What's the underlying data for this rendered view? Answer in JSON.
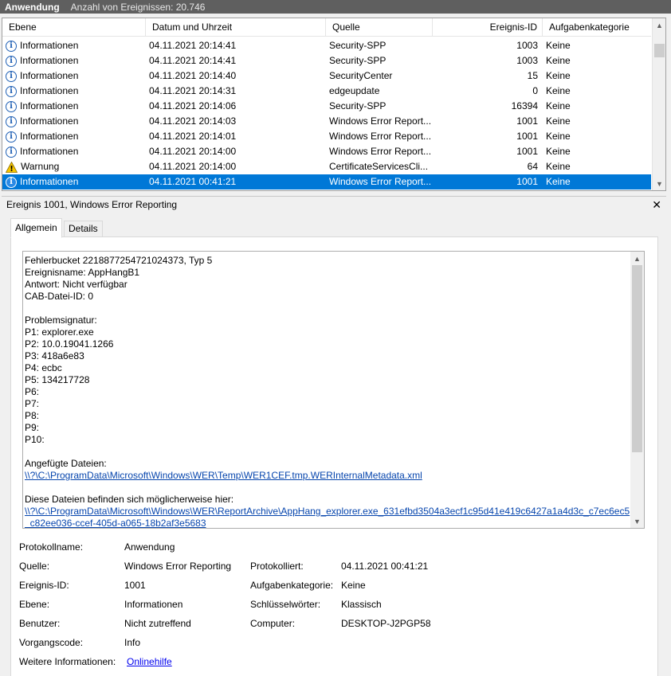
{
  "topbar": {
    "title": "Anwendung",
    "count_label": "Anzahl von Ereignissen: 20.746"
  },
  "columns": {
    "level": "Ebene",
    "date": "Datum und Uhrzeit",
    "source": "Quelle",
    "event_id": "Ereignis-ID",
    "category": "Aufgabenkategorie"
  },
  "rows": [
    {
      "icon": "info-icon",
      "level": "Informationen",
      "date": "04.11.2021 20:14:41",
      "source": "Security-SPP",
      "id": "1003",
      "category": "Keine"
    },
    {
      "icon": "info-icon",
      "level": "Informationen",
      "date": "04.11.2021 20:14:41",
      "source": "Security-SPP",
      "id": "1003",
      "category": "Keine"
    },
    {
      "icon": "info-icon",
      "level": "Informationen",
      "date": "04.11.2021 20:14:40",
      "source": "SecurityCenter",
      "id": "15",
      "category": "Keine"
    },
    {
      "icon": "info-icon",
      "level": "Informationen",
      "date": "04.11.2021 20:14:31",
      "source": "edgeupdate",
      "id": "0",
      "category": "Keine"
    },
    {
      "icon": "info-icon",
      "level": "Informationen",
      "date": "04.11.2021 20:14:06",
      "source": "Security-SPP",
      "id": "16394",
      "category": "Keine"
    },
    {
      "icon": "info-icon",
      "level": "Informationen",
      "date": "04.11.2021 20:14:03",
      "source": "Windows Error Report...",
      "id": "1001",
      "category": "Keine"
    },
    {
      "icon": "info-icon",
      "level": "Informationen",
      "date": "04.11.2021 20:14:01",
      "source": "Windows Error Report...",
      "id": "1001",
      "category": "Keine"
    },
    {
      "icon": "info-icon",
      "level": "Informationen",
      "date": "04.11.2021 20:14:00",
      "source": "Windows Error Report...",
      "id": "1001",
      "category": "Keine"
    },
    {
      "icon": "warning-icon",
      "level": "Warnung",
      "date": "04.11.2021 20:14:00",
      "source": "CertificateServicesCli...",
      "id": "64",
      "category": "Keine"
    },
    {
      "icon": "info-icon",
      "level": "Informationen",
      "date": "04.11.2021 00:41:21",
      "source": "Windows Error Report...",
      "id": "1001",
      "category": "Keine",
      "selected": true
    }
  ],
  "detail": {
    "title": "Ereignis 1001, Windows Error Reporting",
    "close": "✕",
    "tabs": [
      "Allgemein",
      "Details"
    ],
    "description_lines": [
      "Fehlerbucket 2218877254721024373, Typ 5",
      "Ereignisname: AppHangB1",
      "Antwort: Nicht verfügbar",
      "CAB-Datei-ID: 0",
      "",
      "Problemsignatur:",
      "P1: explorer.exe",
      "P2: 10.0.19041.1266",
      "P3: 418a6e83",
      "P4: ecbc",
      "P5: 134217728",
      "P6:",
      "P7:",
      "P8:",
      "P9:",
      "P10:",
      "",
      "Angefügte Dateien:"
    ],
    "attached_link": "\\\\?\\C:\\ProgramData\\Microsoft\\Windows\\WER\\Temp\\WER1CEF.tmp.WERInternalMetadata.xml",
    "archive_intro": "Diese Dateien befinden sich möglicherweise hier:",
    "archive_link_1": "\\\\?\\C:\\ProgramData\\Microsoft\\Windows\\WER\\ReportArchive\\AppHang_explorer.exe_631efbd3504a3ecf1c95d41e419c6427a1a4d3c_c7ec6ec5",
    "archive_link_2": "_c82ee036-ccef-405d-a065-18b2af3e5683"
  },
  "properties": {
    "protokollname_label": "Protokollname:",
    "protokollname_value": "Anwendung",
    "quelle_label": "Quelle:",
    "quelle_value": "Windows Error Reporting",
    "protokolliert_label": "Protokolliert:",
    "protokolliert_value": "04.11.2021 00:41:21",
    "ereignis_id_label": "Ereignis-ID:",
    "ereignis_id_value": "1001",
    "aufgabenkategorie_label": "Aufgabenkategorie:",
    "aufgabenkategorie_value": "Keine",
    "ebene_label": "Ebene:",
    "ebene_value": "Informationen",
    "schluesselwoerter_label": "Schlüsselwörter:",
    "schluesselwoerter_value": "Klassisch",
    "benutzer_label": "Benutzer:",
    "benutzer_value": "Nicht zutreffend",
    "computer_label": "Computer:",
    "computer_value": "DESKTOP-J2PGP58",
    "vorgangscode_label": "Vorgangscode:",
    "vorgangscode_value": "Info",
    "weitere_label": "Weitere Informationen:",
    "weitere_link": "Onlinehilfe"
  }
}
